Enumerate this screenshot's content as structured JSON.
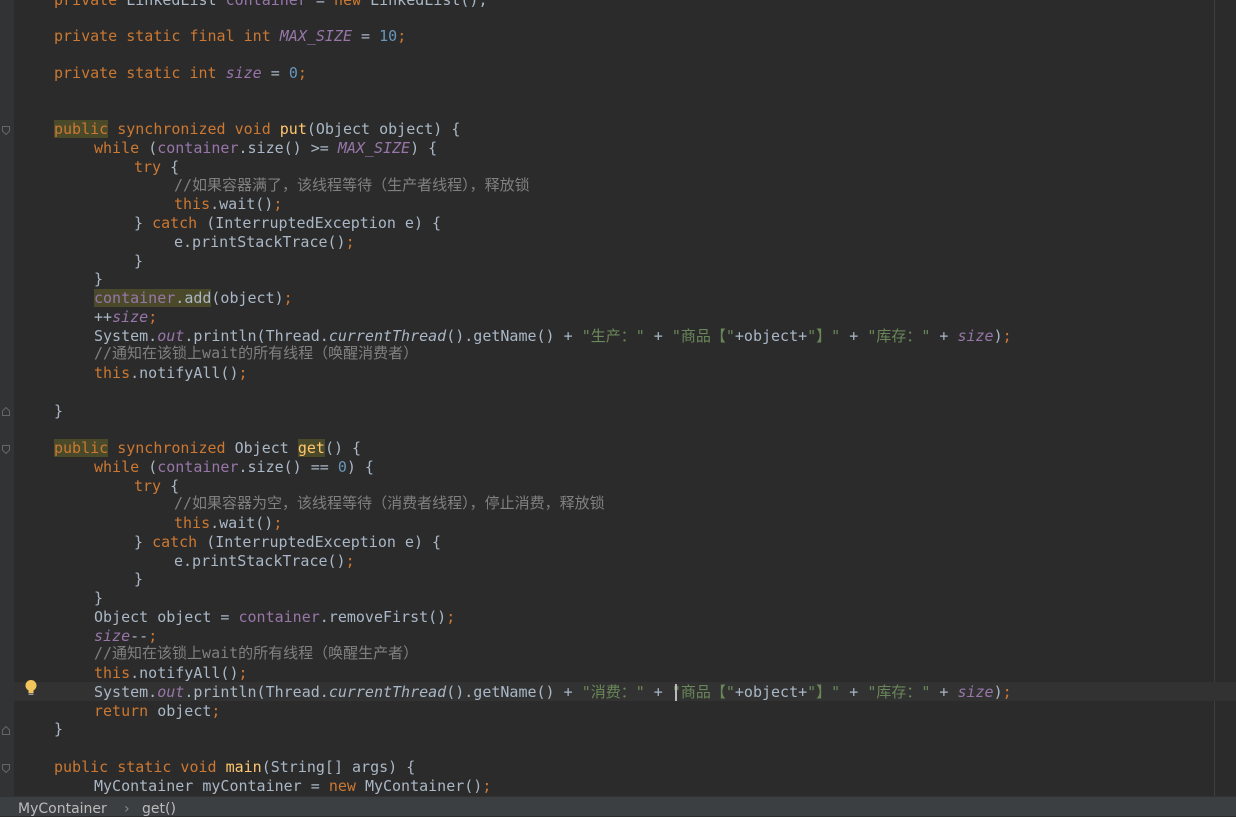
{
  "editor": {
    "lines": {
      "l01": {
        "a": "private ",
        "b": "LinkedList ",
        "c": "container",
        "d": " = ",
        "e": "new ",
        "f": "LinkedList();"
      },
      "l02": {
        "a": "private static final int ",
        "b": "MAX_SIZE",
        "c": " = ",
        "d": "10",
        "e": ";"
      },
      "l03": {
        "a": "private static int ",
        "b": "size",
        "c": " = ",
        "d": "0",
        "e": ";"
      },
      "l04": {
        "a": "public",
        "b": " synchronized void ",
        "c": "put",
        "d": "(Object object) {"
      },
      "l05": {
        "a": "while ",
        "b": "(",
        "c": "container",
        "d": ".size() >= ",
        "e": "MAX_SIZE",
        "f": ") {"
      },
      "l06": {
        "a": "try ",
        "b": "{"
      },
      "l07": {
        "a": "//如果容器满了，该线程等待（生产者线程），释放锁"
      },
      "l08": {
        "a": "this",
        "b": ".wait()",
        "c": ";"
      },
      "l09": {
        "a": "} ",
        "b": "catch ",
        "c": "(InterruptedException e) {"
      },
      "l10": {
        "a": "e.printStackTrace()",
        "b": ";"
      },
      "l11": {
        "a": "}"
      },
      "l12": {
        "a": "}"
      },
      "l13": {
        "a": "container",
        "b": ".",
        "c": "add",
        "d": "(object)",
        "e": ";"
      },
      "l14": {
        "a": "++",
        "b": "size",
        "c": ";"
      },
      "l15": {
        "a": "System.",
        "b": "out",
        "c": ".println(Thread.",
        "d": "currentThread",
        "e": "().getName() + ",
        "f": "\"生产：\"",
        "g": " + ",
        "h": "\"商品【\"",
        "i": "+object+",
        "j": "\"】\"",
        "k": " + ",
        "l": "\"库存：\"",
        "m": " + ",
        "n": "size",
        "o": ")",
        "p": ";"
      },
      "l16": {
        "a": "//通知在该锁上wait的所有线程（唤醒消费者）"
      },
      "l17": {
        "a": "this",
        "b": ".notifyAll()",
        "c": ";"
      },
      "l18": {
        "a": "}"
      },
      "l19": {
        "a": "public",
        "b": " synchronized ",
        "c": "Object ",
        "d": "get",
        "e": "() {"
      },
      "l20": {
        "a": "while ",
        "b": "(",
        "c": "container",
        "d": ".size() == ",
        "e": "0",
        "f": ") {"
      },
      "l21": {
        "a": "try ",
        "b": "{"
      },
      "l22": {
        "a": "//如果容器为空，该线程等待（消费者线程），停止消费，释放锁"
      },
      "l23": {
        "a": "this",
        "b": ".wait()",
        "c": ";"
      },
      "l24": {
        "a": "} ",
        "b": "catch ",
        "c": "(InterruptedException e) {"
      },
      "l25": {
        "a": "e.printStackTrace()",
        "b": ";"
      },
      "l26": {
        "a": "}"
      },
      "l27": {
        "a": "}"
      },
      "l28": {
        "a": "Object object = ",
        "b": "container",
        "c": ".removeFirst()",
        "d": ";"
      },
      "l29": {
        "a": "size",
        "b": "--",
        "c": ";"
      },
      "l30": {
        "a": "//通知在该锁上wait的所有线程（唤醒生产者）"
      },
      "l31": {
        "a": "this",
        "b": ".notifyAll()",
        "c": ";"
      },
      "l32": {
        "a": "System.",
        "b": "out",
        "c": ".println(Thread.",
        "d": "currentThread",
        "e": "().getName() + ",
        "f": "\"消费：\"",
        "g": " + ",
        "h": "\"商品【\"",
        "i": "+object+",
        "j": "\"】\"",
        "k": " + ",
        "l": "\"库存：\"",
        "m": " + ",
        "n": "size",
        "o": ")",
        "p": ";"
      },
      "l33": {
        "a": "return ",
        "b": "object",
        "c": ";"
      },
      "l34": {
        "a": "}"
      },
      "l35": {
        "a": "public static void ",
        "b": "main",
        "c": "(String[] args) {"
      },
      "l36": {
        "a": "MyContainer myContainer = ",
        "b": "new ",
        "c": "MyContainer()",
        "d": ";"
      }
    }
  },
  "breadcrumb": {
    "class_name": "MyContainer",
    "separator": "›",
    "method_name": "get()"
  },
  "icons": {
    "fold": "fold-marker-icon",
    "bulb": "intention-bulb-icon"
  },
  "colors": {
    "background": "#2b2b2b",
    "keyword": "#cc7832",
    "string": "#6a8759",
    "number": "#6897bb",
    "field": "#9876aa",
    "method": "#ffc66d",
    "comment": "#808080",
    "text": "#a9b7c6"
  }
}
